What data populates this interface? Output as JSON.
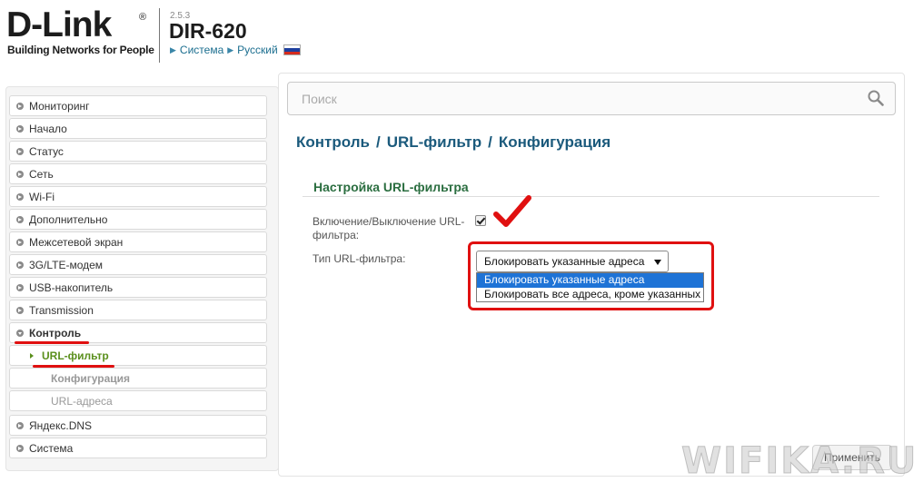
{
  "header": {
    "logo": "D-Link",
    "logo_reg": "®",
    "tagline": "Building Networks for People",
    "version": "2.5.3",
    "model": "DIR-620",
    "links": [
      "Система",
      "Русский"
    ]
  },
  "sidebar": {
    "items": [
      {
        "label": "Мониторинг"
      },
      {
        "label": "Начало"
      },
      {
        "label": "Статус"
      },
      {
        "label": "Сеть"
      },
      {
        "label": "Wi-Fi"
      },
      {
        "label": "Дополнительно"
      },
      {
        "label": "Межсетевой экран"
      },
      {
        "label": "3G/LTE-модем"
      },
      {
        "label": "USB-накопитель"
      },
      {
        "label": "Transmission"
      },
      {
        "label": "Контроль"
      },
      {
        "label": "URL-фильтр"
      },
      {
        "label": "Конфигурация"
      },
      {
        "label": "URL-адреса"
      },
      {
        "label": "Яндекс.DNS"
      },
      {
        "label": "Система"
      }
    ]
  },
  "search": {
    "placeholder": "Поиск"
  },
  "breadcrumb": [
    "Контроль",
    "/",
    "URL-фильтр",
    "/",
    "Конфигурация"
  ],
  "section": {
    "title": "Настройка URL-фильтра",
    "enable_label_line1": "Включение/Выключение URL-",
    "enable_label_line2": "фильтра:",
    "enable_checked": true,
    "type_label": "Тип URL-фильтра:",
    "type_selected": "Блокировать указанные адреса",
    "type_options": [
      "Блокировать указанные адреса",
      "Блокировать все адреса, кроме указанных"
    ]
  },
  "apply_label": "Применить",
  "watermark": "WIFIKA.RU",
  "colors": {
    "accent": "#1b5a7c",
    "highlight_red": "#e01010",
    "selection_blue": "#1e73d6"
  }
}
